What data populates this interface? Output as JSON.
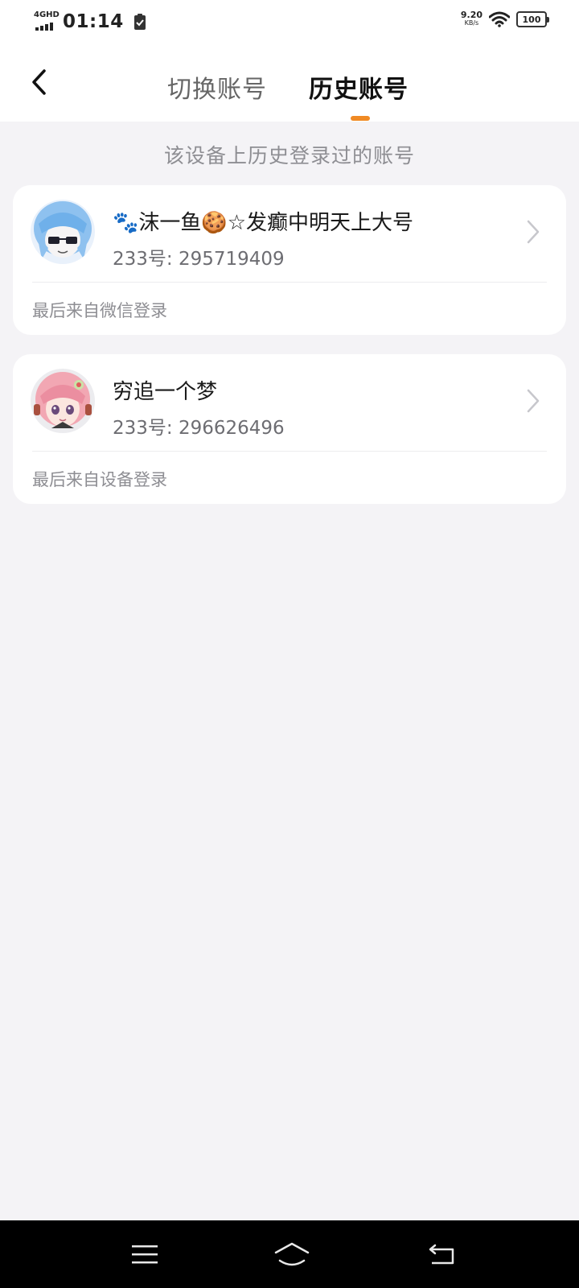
{
  "status_bar": {
    "network": "4GHD",
    "time": "01:14",
    "speed_value": "9.20",
    "speed_unit": "KB/s",
    "battery": "100"
  },
  "header": {
    "back_icon": "chevron-left-icon",
    "tabs": [
      {
        "label": "切换账号",
        "active": false
      },
      {
        "label": "历史账号",
        "active": true
      }
    ],
    "accent_color": "#f08a24"
  },
  "subtitle": "该设备上历史登录过的账号",
  "accounts": [
    {
      "name": "🐾沫一鱼🍪☆发癫中明天上大号",
      "account_id": "233号: 295719409",
      "login_source": "最后来自微信登录",
      "avatar": "blue-hair-anime-avatar"
    },
    {
      "name": "穷追一个梦",
      "account_id": "233号: 296626496",
      "login_source": "最后来自设备登录",
      "avatar": "pink-hair-anime-avatar"
    }
  ],
  "nav_bar": {
    "menu_icon": "menu-icon",
    "home_icon": "home-icon",
    "back_icon": "back-icon"
  }
}
